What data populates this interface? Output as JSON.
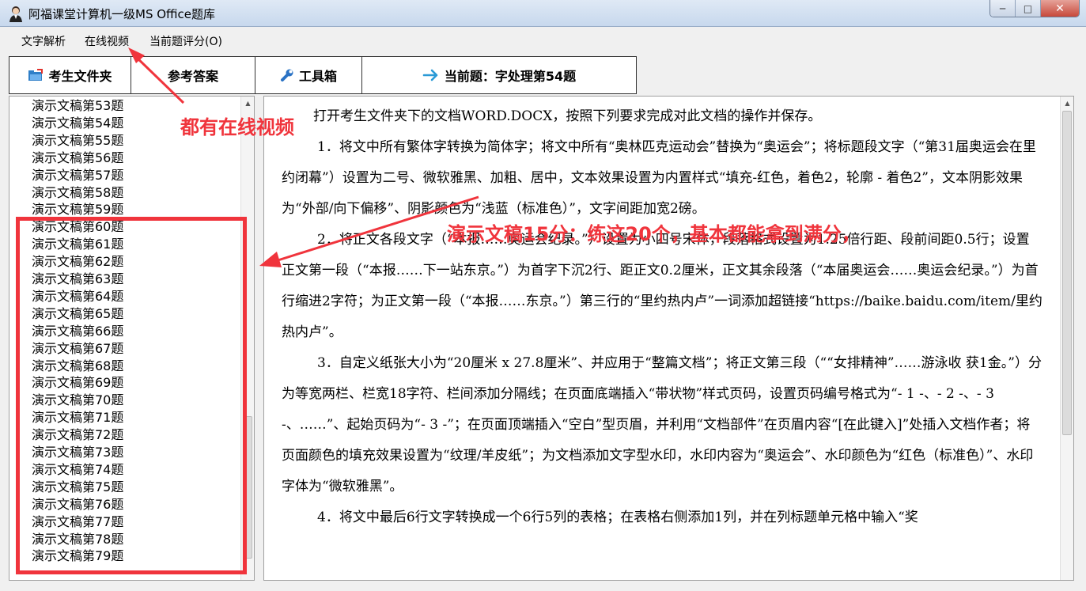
{
  "window": {
    "title": "阿福课堂计算机一级MS Office题库",
    "minimize": "─",
    "maximize": "□",
    "close": "✕"
  },
  "menu": [
    "文字解析",
    "在线视频",
    "当前题评分(O)"
  ],
  "toolbar": {
    "student_folder": "考生文件夹",
    "reference_answer": "参考答案",
    "toolbox": "工具箱",
    "current_question": "当前题：字处理第54题"
  },
  "list_items": [
    "演示文稿第53题",
    "演示文稿第54题",
    "演示文稿第55题",
    "演示文稿第56题",
    "演示文稿第57题",
    "演示文稿第58题",
    "演示文稿第59题",
    "演示文稿第60题",
    "演示文稿第61题",
    "演示文稿第62题",
    "演示文稿第63题",
    "演示文稿第64题",
    "演示文稿第65题",
    "演示文稿第66题",
    "演示文稿第67题",
    "演示文稿第68题",
    "演示文稿第69题",
    "演示文稿第70题",
    "演示文稿第71题",
    "演示文稿第72题",
    "演示文稿第73题",
    "演示文稿第74题",
    "演示文稿第75题",
    "演示文稿第76题",
    "演示文稿第77题",
    "演示文稿第78题",
    "演示文稿第79题"
  ],
  "content": {
    "p0": "打开考生文件夹下的文档WORD.DOCX，按照下列要求完成对此文档的操作并保存。",
    "p1": "1．将文中所有繁体字转换为简体字；将文中所有“奥林匹克运动会”替换为“奥运会”；将标题段文字（“第31届奥运会在里约闭幕”）设置为二号、微软雅黑、加粗、居中，文本效果设置为内置样式“填充-红色，着色2，轮廓 - 着色2”，文本阴影效果为“外部/向下偏移”、阴影颜色为“浅蓝（标准色）”，文字间距加宽2磅。",
    "p2": "2．将正文各段文字（“本报……奥运会纪录。”）设置为小四号宋体，段落格式设置为1.25倍行距、段前间距0.5行；设置正文第一段（“本报……下一站东京。”）为首字下沉2行、距正文0.2厘米，正文其余段落（“本届奥运会……奥运会纪录。”）为首行缩进2字符；为正文第一段（“本报……东京。”）第三行的“里约热内卢”一词添加超链接“https://baike.baidu.com/item/里约热内卢”。",
    "p3": "3．自定义纸张大小为“20厘米 x 27.8厘米”、并应用于“整篇文档”；将正文第三段（““女排精神”……游泳收 获1金。”）分为等宽两栏、栏宽18字符、栏间添加分隔线；在页面底端插入“带状物”样式页码，设置页码编号格式为“- 1 -、- 2 -、- 3 -、……”、起始页码为“- 3 -”；在页面顶端插入“空白”型页眉，并利用“文档部件”在页眉内容“[在此键入]”处插入文档作者；将页面颜色的填充效果设置为“纹理/羊皮纸”；为文档添加文字型水印，水印内容为“奥运会”、水印颜色为“红色（标准色）”、水印字体为“微软雅黑”。",
    "p4": "4．将文中最后6行文字转换成一个6行5列的表格；在表格右侧添加1列，并在列标题单元格中输入“奖"
  },
  "annotations": {
    "video_note": "都有在线视频",
    "slides_note": "演示文稿15分：练这20个，基本都能拿到满分，"
  },
  "colors": {
    "annotation_red": "#f0343c",
    "arrow_blue": "#2a9ad6"
  }
}
